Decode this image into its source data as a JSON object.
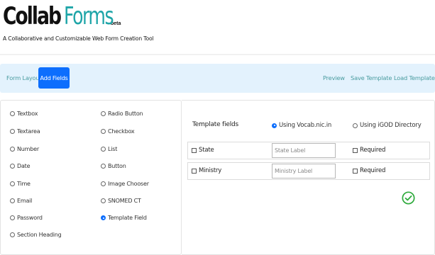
{
  "header": {
    "logo_collab": "Collab",
    "logo_forms": "Forms",
    "logo_beta": "beta",
    "tagline": "A Collaborative and Customizable Web Form Creation Tool"
  },
  "nav": {
    "form_layout": "Form Layout",
    "add_fields": "Add Fields",
    "preview": "Preview",
    "save_template": "Save Template",
    "load_template": "Load Template"
  },
  "field_types": {
    "col1": [
      "Textbox",
      "Textarea",
      "Number",
      "Date",
      "Time",
      "Email",
      "Password",
      "Section Heading"
    ],
    "col2": [
      "Radio Button",
      "Checkbox",
      "List",
      "Button",
      "Image Chooser",
      "SNOMED CT",
      "Template Field"
    ],
    "selected": "Template Field"
  },
  "template": {
    "title": "Template fields",
    "source_options": [
      "Using Vocab.nic.in",
      "Using iGOD Directory"
    ],
    "selected_source": "Using Vocab.nic.in",
    "rows": [
      {
        "name": "State",
        "label_placeholder": "State Label",
        "required_label": "Required"
      },
      {
        "name": "Ministry",
        "label_placeholder": "Ministry Label",
        "required_label": "Required"
      }
    ]
  },
  "colors": {
    "accent_blue": "#0d6efd",
    "nav_bg": "#e3f2fd",
    "nav_link": "#4a9ca0",
    "logo_teal": "#1ea5a8",
    "success_green": "#2eaa3c"
  },
  "icons": {
    "confirm": "check-circle-icon"
  }
}
